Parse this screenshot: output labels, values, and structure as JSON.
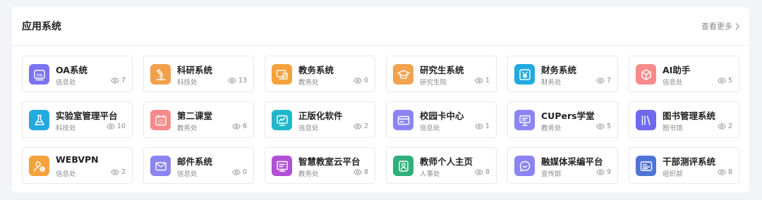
{
  "header": {
    "title": "应用系统",
    "more_label": "查看更多"
  },
  "apps": [
    {
      "name": "OA系统",
      "dept": "信息处",
      "views": "7",
      "icon": "oa-icon",
      "color": "#7b73f0"
    },
    {
      "name": "科研系统",
      "dept": "科技处",
      "views": "13",
      "icon": "microscope-icon",
      "color": "#f2a04c"
    },
    {
      "name": "教务系统",
      "dept": "教务处",
      "views": "0",
      "icon": "monitor-icon",
      "color": "#f5a23c"
    },
    {
      "name": "研究生系统",
      "dept": "研究生院",
      "views": "1",
      "icon": "graduation-cap-icon",
      "color": "#f2a251"
    },
    {
      "name": "财务系统",
      "dept": "财务处",
      "views": "7",
      "icon": "yen-icon",
      "color": "#22a9e0"
    },
    {
      "name": "AI助手",
      "dept": "信息处",
      "views": "5",
      "icon": "cube-icon",
      "color": "#f78a8a"
    },
    {
      "name": "实验室管理平台",
      "dept": "科技处",
      "views": "10",
      "icon": "flask-icon",
      "color": "#22a9e0"
    },
    {
      "name": "第二课堂",
      "dept": "教务处",
      "views": "6",
      "icon": "calendar-icon",
      "color": "#f78a8a"
    },
    {
      "name": "正版化软件",
      "dept": "信息处",
      "views": "2",
      "icon": "chart-monitor-icon",
      "color": "#20b8c8"
    },
    {
      "name": "校园卡中心",
      "dept": "信息处",
      "views": "1",
      "icon": "card-icon",
      "color": "#8c84f2"
    },
    {
      "name": "CUPers学堂",
      "dept": "教务处",
      "views": "5",
      "icon": "presentation-icon",
      "color": "#8c84f2"
    },
    {
      "name": "图书管理系统",
      "dept": "图书馆",
      "views": "2",
      "icon": "books-icon",
      "color": "#6f69ee"
    },
    {
      "name": "WEBVPN",
      "dept": "信息处",
      "views": "2",
      "icon": "user-globe-icon",
      "color": "#f5a23c"
    },
    {
      "name": "邮件系统",
      "dept": "信息处",
      "views": "0",
      "icon": "mail-icon",
      "color": "#8c84f2"
    },
    {
      "name": "智慧教室云平台",
      "dept": "教务处",
      "views": "8",
      "icon": "classroom-icon",
      "color": "#b14fd6"
    },
    {
      "name": "教师个人主页",
      "dept": "人事处",
      "views": "8",
      "icon": "teacher-icon",
      "color": "#2fb07a"
    },
    {
      "name": "融媒体采编平台",
      "dept": "宣传部",
      "views": "9",
      "icon": "chat-bubble-icon",
      "color": "#8c84f2"
    },
    {
      "name": "干部测评系统",
      "dept": "组织部",
      "views": "8",
      "icon": "id-card-icon",
      "color": "#4f74d6"
    }
  ]
}
